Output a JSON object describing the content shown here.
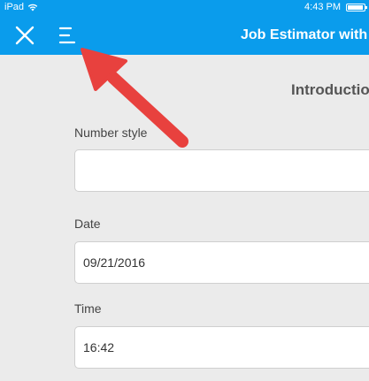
{
  "status_bar": {
    "device": "iPad",
    "time": "4:43 PM"
  },
  "header": {
    "title": "Job Estimator with",
    "close_icon": "close-icon",
    "menu_icon": "menu-icon"
  },
  "form": {
    "section_title": "Introductio",
    "fields": [
      {
        "label": "Number style",
        "value": ""
      },
      {
        "label": "Date",
        "value": "09/21/2016"
      },
      {
        "label": "Time",
        "value": "16:42"
      }
    ]
  },
  "colors": {
    "header": "#0a9cec",
    "arrow": "#e8413e",
    "background": "#ebebeb"
  }
}
